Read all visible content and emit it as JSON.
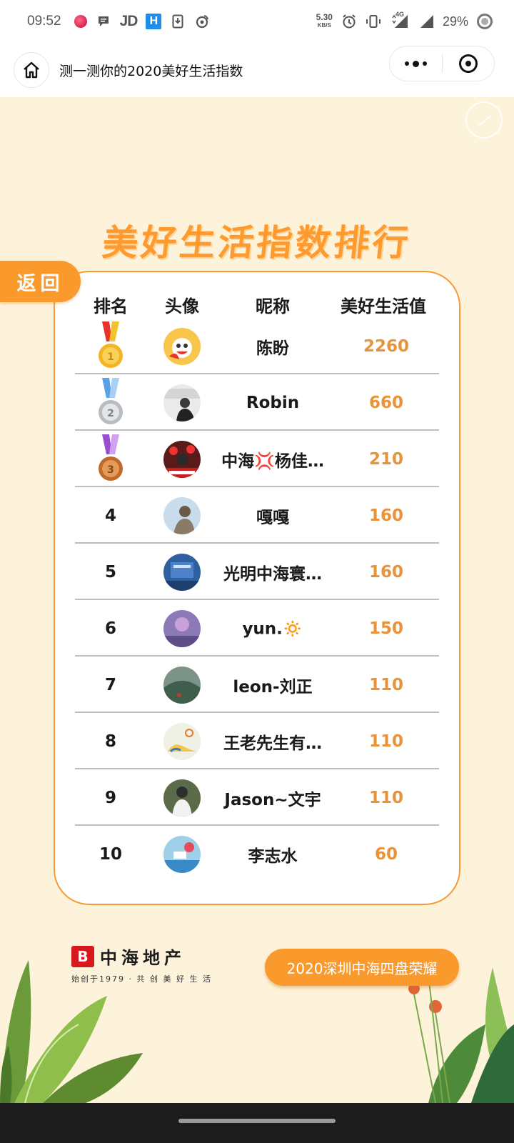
{
  "status_bar": {
    "time": "09:52",
    "jd": "JD",
    "h_badge": "H",
    "net_speed": "5.30",
    "net_unit": "KB/S",
    "network": "4G",
    "battery": "29%"
  },
  "title_bar": {
    "title": "测一测你的2020美好生活指数"
  },
  "page": {
    "heading": "美好生活指数排行",
    "back_label": "返回",
    "columns": {
      "rank": "排名",
      "avatar": "头像",
      "nickname": "昵称",
      "score": "美好生活值"
    },
    "rows": [
      {
        "rank": "1",
        "name": "陈盼",
        "score": "2260"
      },
      {
        "rank": "2",
        "name": "Robin",
        "score": "660"
      },
      {
        "rank": "3",
        "name": "中海💢杨佳…",
        "score": "210"
      },
      {
        "rank": "4",
        "name": "嘎嘎",
        "score": "160"
      },
      {
        "rank": "5",
        "name": "光明中海寰…",
        "score": "160"
      },
      {
        "rank": "6",
        "name": "yun.🔅",
        "score": "150"
      },
      {
        "rank": "7",
        "name": "leon-刘正",
        "score": "110"
      },
      {
        "rank": "8",
        "name": "王老先生有…",
        "score": "110"
      },
      {
        "rank": "9",
        "name": "Jason~文宇",
        "score": "110"
      },
      {
        "rank": "10",
        "name": "李志水",
        "score": "60"
      }
    ],
    "brand": {
      "name": "中海地产",
      "tagline": "始创于1979 · 共 创 美 好 生 活"
    },
    "honor_button": "2020深圳中海四盘荣耀"
  },
  "colors": {
    "accent": "#fb9a2c",
    "score": "#e8923a",
    "background": "#fdf3da"
  }
}
